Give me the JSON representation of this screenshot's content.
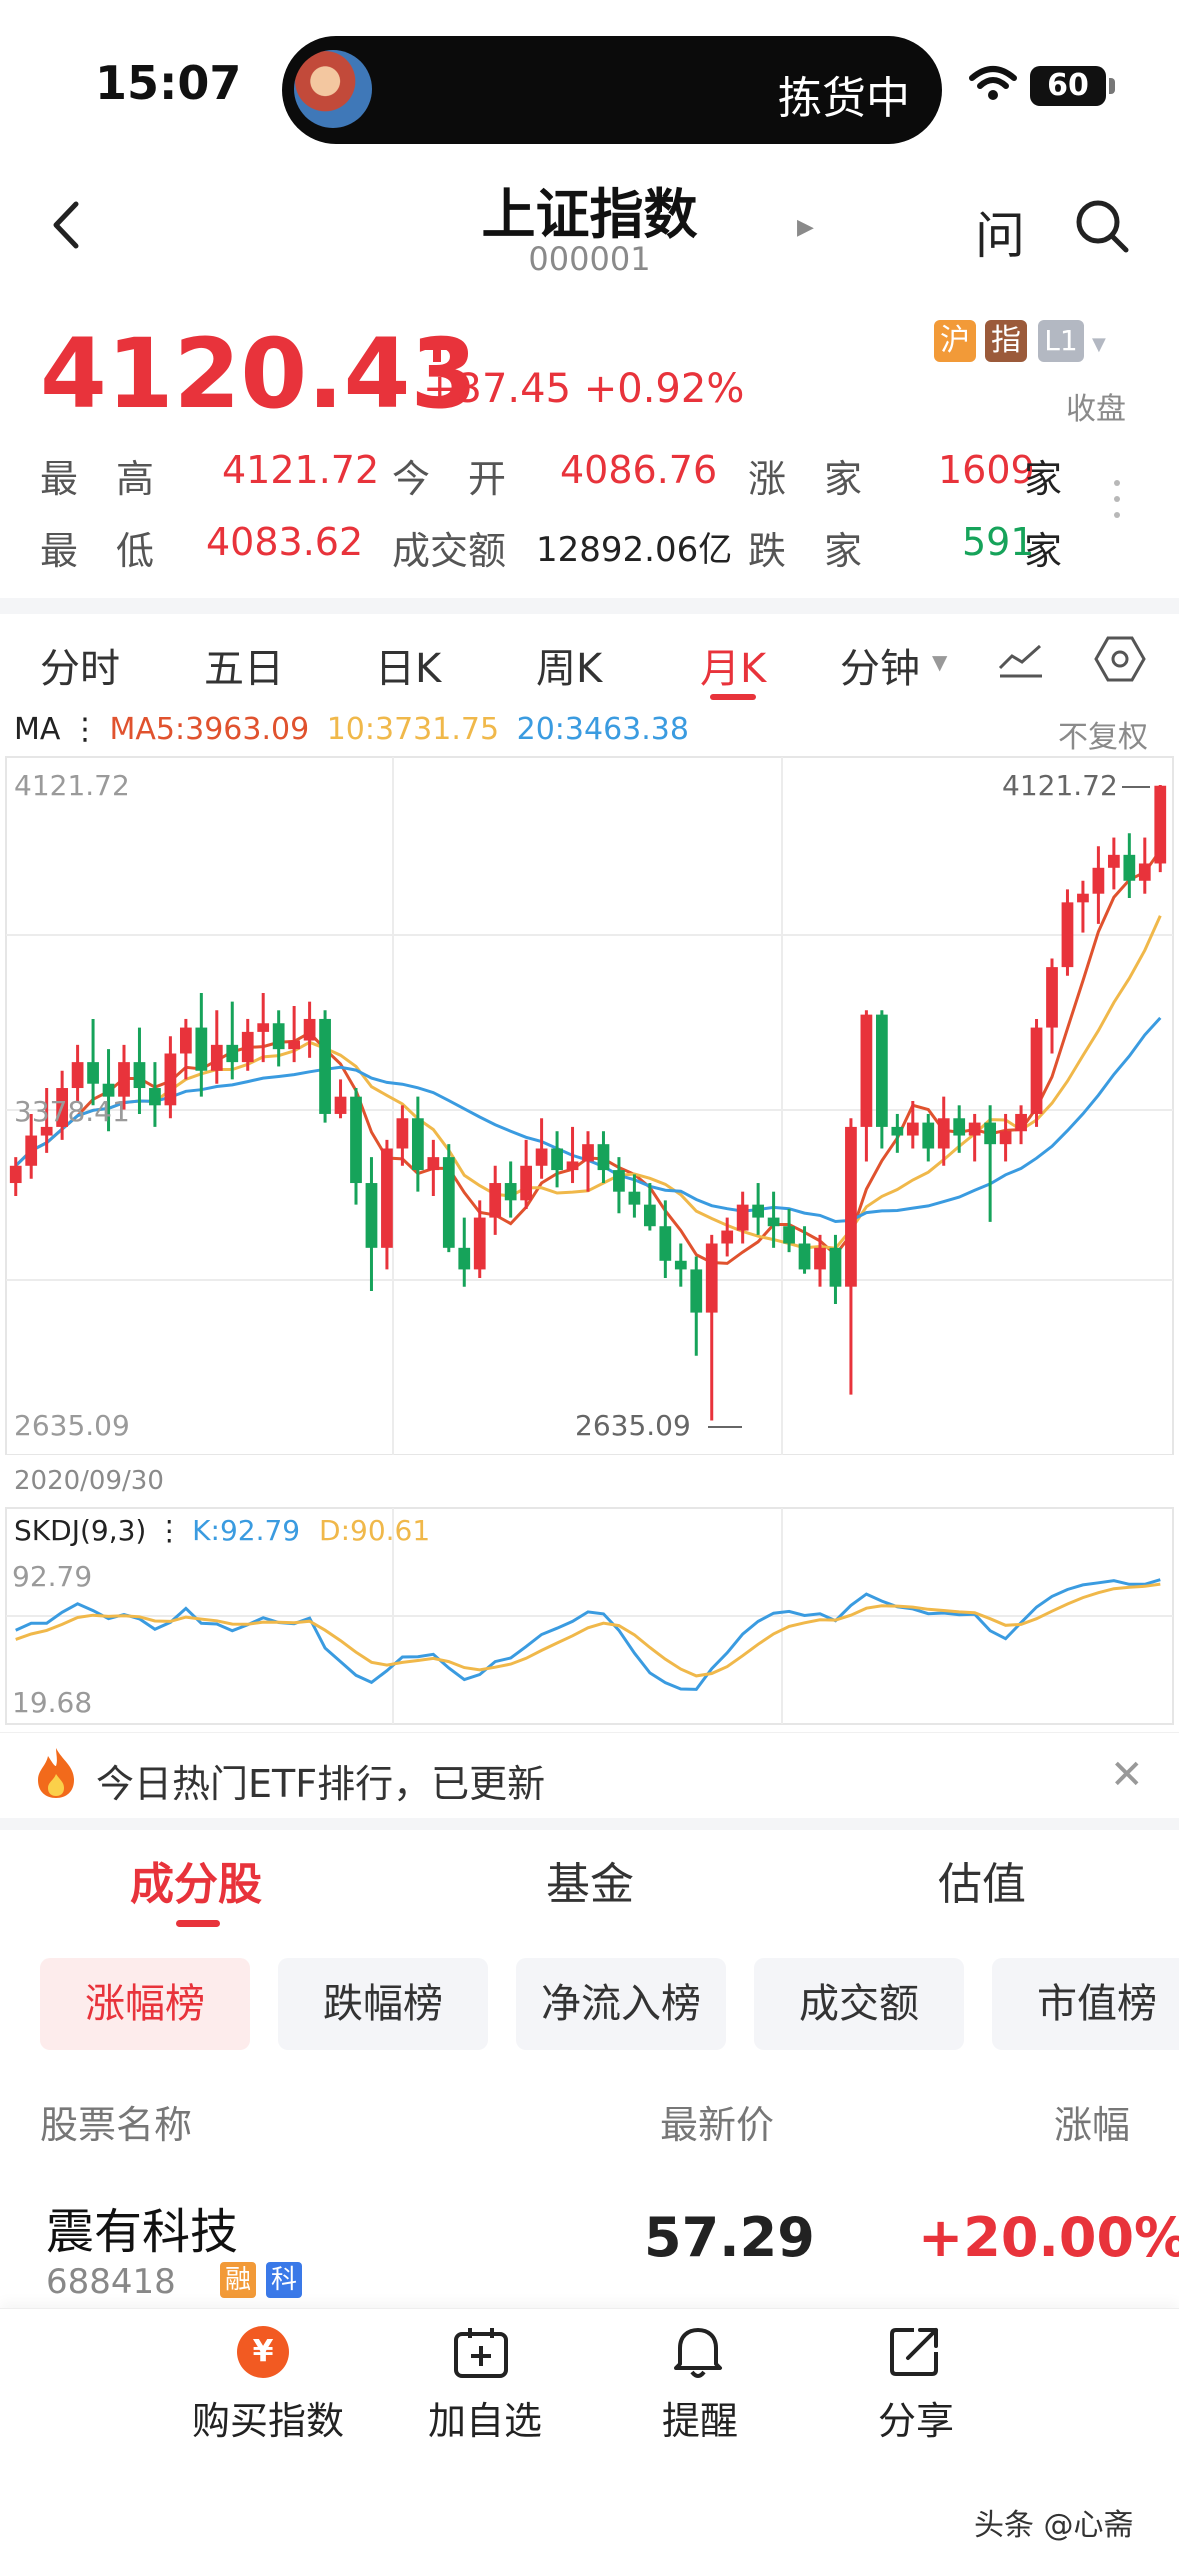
{
  "status_bar": {
    "time": "15:07",
    "island_text": "拣货中",
    "battery": "60"
  },
  "header": {
    "title": "上证指数",
    "code": "000001",
    "ask_label": "问"
  },
  "quote": {
    "price": "4120.43",
    "change": "+37.45 +0.92%",
    "tags": [
      "沪",
      "指",
      "L1"
    ],
    "market_status": "收盘",
    "stats": {
      "high_label": "最　高",
      "high": "4121.72",
      "open_label": "今　开",
      "open": "4086.76",
      "up_label": "涨　家",
      "up": "1609",
      "up_unit": "家",
      "low_label": "最　低",
      "low": "4083.62",
      "turnover_label": "成交额",
      "turnover": "12892.06亿",
      "down_label": "跌　家",
      "down": "591",
      "down_unit": "家"
    }
  },
  "period_tabs": [
    "分时",
    "五日",
    "日K",
    "周K",
    "月K",
    "分钟"
  ],
  "active_period": "月K",
  "ma_legend": {
    "title": "MA",
    "ma5": "MA5:3963.09",
    "ma10": "10:3731.75",
    "ma20": "20:3463.38",
    "adjust": "不复权"
  },
  "main_chart_labels": {
    "top": "4121.72",
    "mid": "3378.41",
    "bottom": "2635.09",
    "max_marker": "4121.72",
    "min_marker": "2635.09",
    "start_date": "2020/09/30"
  },
  "kdj_legend": {
    "title": "SKDJ(9,3)",
    "k": "K:92.79",
    "d": "D:90.61",
    "top": "92.79",
    "bottom": "19.68"
  },
  "colors": {
    "up": "#e8333b",
    "down": "#16a35a",
    "ma5": "#e0522e",
    "ma10": "#f0b84a",
    "ma20": "#3a9be0",
    "k": "#3a9be0",
    "d": "#f0b84a"
  },
  "chart_data": {
    "type": "candlestick",
    "title": "",
    "ylim": [
      2635.09,
      4121.72
    ],
    "start_date": "2020/09/30",
    "candles": [
      [
        3200,
        3240,
        3260,
        3170
      ],
      [
        3240,
        3310,
        3360,
        3210
      ],
      [
        3310,
        3330,
        3420,
        3270
      ],
      [
        3330,
        3420,
        3460,
        3300
      ],
      [
        3420,
        3480,
        3520,
        3390
      ],
      [
        3480,
        3430,
        3580,
        3380
      ],
      [
        3430,
        3400,
        3510,
        3320
      ],
      [
        3400,
        3480,
        3520,
        3370
      ],
      [
        3480,
        3420,
        3560,
        3360
      ],
      [
        3420,
        3380,
        3480,
        3330
      ],
      [
        3380,
        3500,
        3540,
        3350
      ],
      [
        3500,
        3560,
        3580,
        3440
      ],
      [
        3560,
        3460,
        3640,
        3400
      ],
      [
        3460,
        3520,
        3600,
        3430
      ],
      [
        3520,
        3480,
        3620,
        3440
      ],
      [
        3480,
        3550,
        3580,
        3460
      ],
      [
        3550,
        3570,
        3640,
        3480
      ],
      [
        3570,
        3510,
        3600,
        3470
      ],
      [
        3510,
        3530,
        3610,
        3480
      ],
      [
        3530,
        3580,
        3620,
        3490
      ],
      [
        3580,
        3360,
        3600,
        3340
      ],
      [
        3360,
        3400,
        3440,
        3350
      ],
      [
        3400,
        3200,
        3420,
        3150
      ],
      [
        3200,
        3050,
        3260,
        2950
      ],
      [
        3050,
        3280,
        3300,
        3000
      ],
      [
        3280,
        3350,
        3380,
        3240
      ],
      [
        3350,
        3230,
        3400,
        3180
      ],
      [
        3230,
        3260,
        3300,
        3170
      ],
      [
        3260,
        3050,
        3290,
        3040
      ],
      [
        3050,
        3000,
        3120,
        2960
      ],
      [
        3000,
        3120,
        3160,
        2980
      ],
      [
        3120,
        3200,
        3240,
        3080
      ],
      [
        3200,
        3160,
        3250,
        3120
      ],
      [
        3160,
        3240,
        3300,
        3140
      ],
      [
        3240,
        3280,
        3350,
        3210
      ],
      [
        3280,
        3230,
        3320,
        3190
      ],
      [
        3230,
        3250,
        3330,
        3200
      ],
      [
        3250,
        3290,
        3320,
        3180
      ],
      [
        3290,
        3230,
        3320,
        3200
      ],
      [
        3230,
        3180,
        3260,
        3130
      ],
      [
        3180,
        3150,
        3220,
        3120
      ],
      [
        3150,
        3100,
        3200,
        3090
      ],
      [
        3100,
        3020,
        3160,
        2980
      ],
      [
        3020,
        3000,
        3060,
        2960
      ],
      [
        3000,
        2900,
        3030,
        2800
      ],
      [
        2900,
        3060,
        3080,
        2650
      ],
      [
        3060,
        3090,
        3120,
        3030
      ],
      [
        3090,
        3150,
        3180,
        3060
      ],
      [
        3150,
        3120,
        3200,
        3080
      ],
      [
        3120,
        3100,
        3180,
        3050
      ],
      [
        3100,
        3060,
        3140,
        3040
      ],
      [
        3060,
        3000,
        3100,
        2990
      ],
      [
        3000,
        3050,
        3080,
        2960
      ],
      [
        3050,
        2960,
        3080,
        2920
      ],
      [
        2960,
        3330,
        3350,
        2710
      ],
      [
        3330,
        3590,
        3600,
        3250
      ],
      [
        3590,
        3330,
        3600,
        3280
      ],
      [
        3330,
        3310,
        3360,
        3270
      ],
      [
        3310,
        3340,
        3390,
        3280
      ],
      [
        3340,
        3280,
        3360,
        3250
      ],
      [
        3280,
        3350,
        3400,
        3240
      ],
      [
        3350,
        3310,
        3380,
        3270
      ],
      [
        3310,
        3340,
        3360,
        3250
      ],
      [
        3340,
        3290,
        3380,
        3110
      ],
      [
        3290,
        3320,
        3360,
        3250
      ],
      [
        3320,
        3360,
        3380,
        3290
      ],
      [
        3360,
        3560,
        3580,
        3330
      ],
      [
        3560,
        3700,
        3720,
        3500
      ],
      [
        3700,
        3850,
        3880,
        3680
      ],
      [
        3850,
        3870,
        3900,
        3780
      ],
      [
        3870,
        3930,
        3980,
        3800
      ],
      [
        3930,
        3960,
        4000,
        3880
      ],
      [
        3960,
        3900,
        4010,
        3860
      ],
      [
        3900,
        3940,
        4000,
        3870
      ],
      [
        3940,
        4120,
        4121.72,
        3920
      ]
    ]
  },
  "banner": {
    "text": "今日热门ETF排行，已更新"
  },
  "section_tabs": [
    "成分股",
    "基金",
    "估值"
  ],
  "filter_chips": [
    "涨幅榜",
    "跌幅榜",
    "净流入榜",
    "成交额",
    "市值榜"
  ],
  "list_header": {
    "name": "股票名称",
    "price": "最新价",
    "pct": "涨幅"
  },
  "stocks": [
    {
      "name": "震有科技",
      "code": "688418",
      "badges": [
        "融",
        "科"
      ],
      "price": "57.29",
      "pct": "+20.00%"
    }
  ],
  "bottom_bar": {
    "buy": "购买指数",
    "buy_icon": "¥",
    "watch": "加自选",
    "alert": "提醒",
    "share": "分享"
  },
  "watermark": "头条 @心斋"
}
